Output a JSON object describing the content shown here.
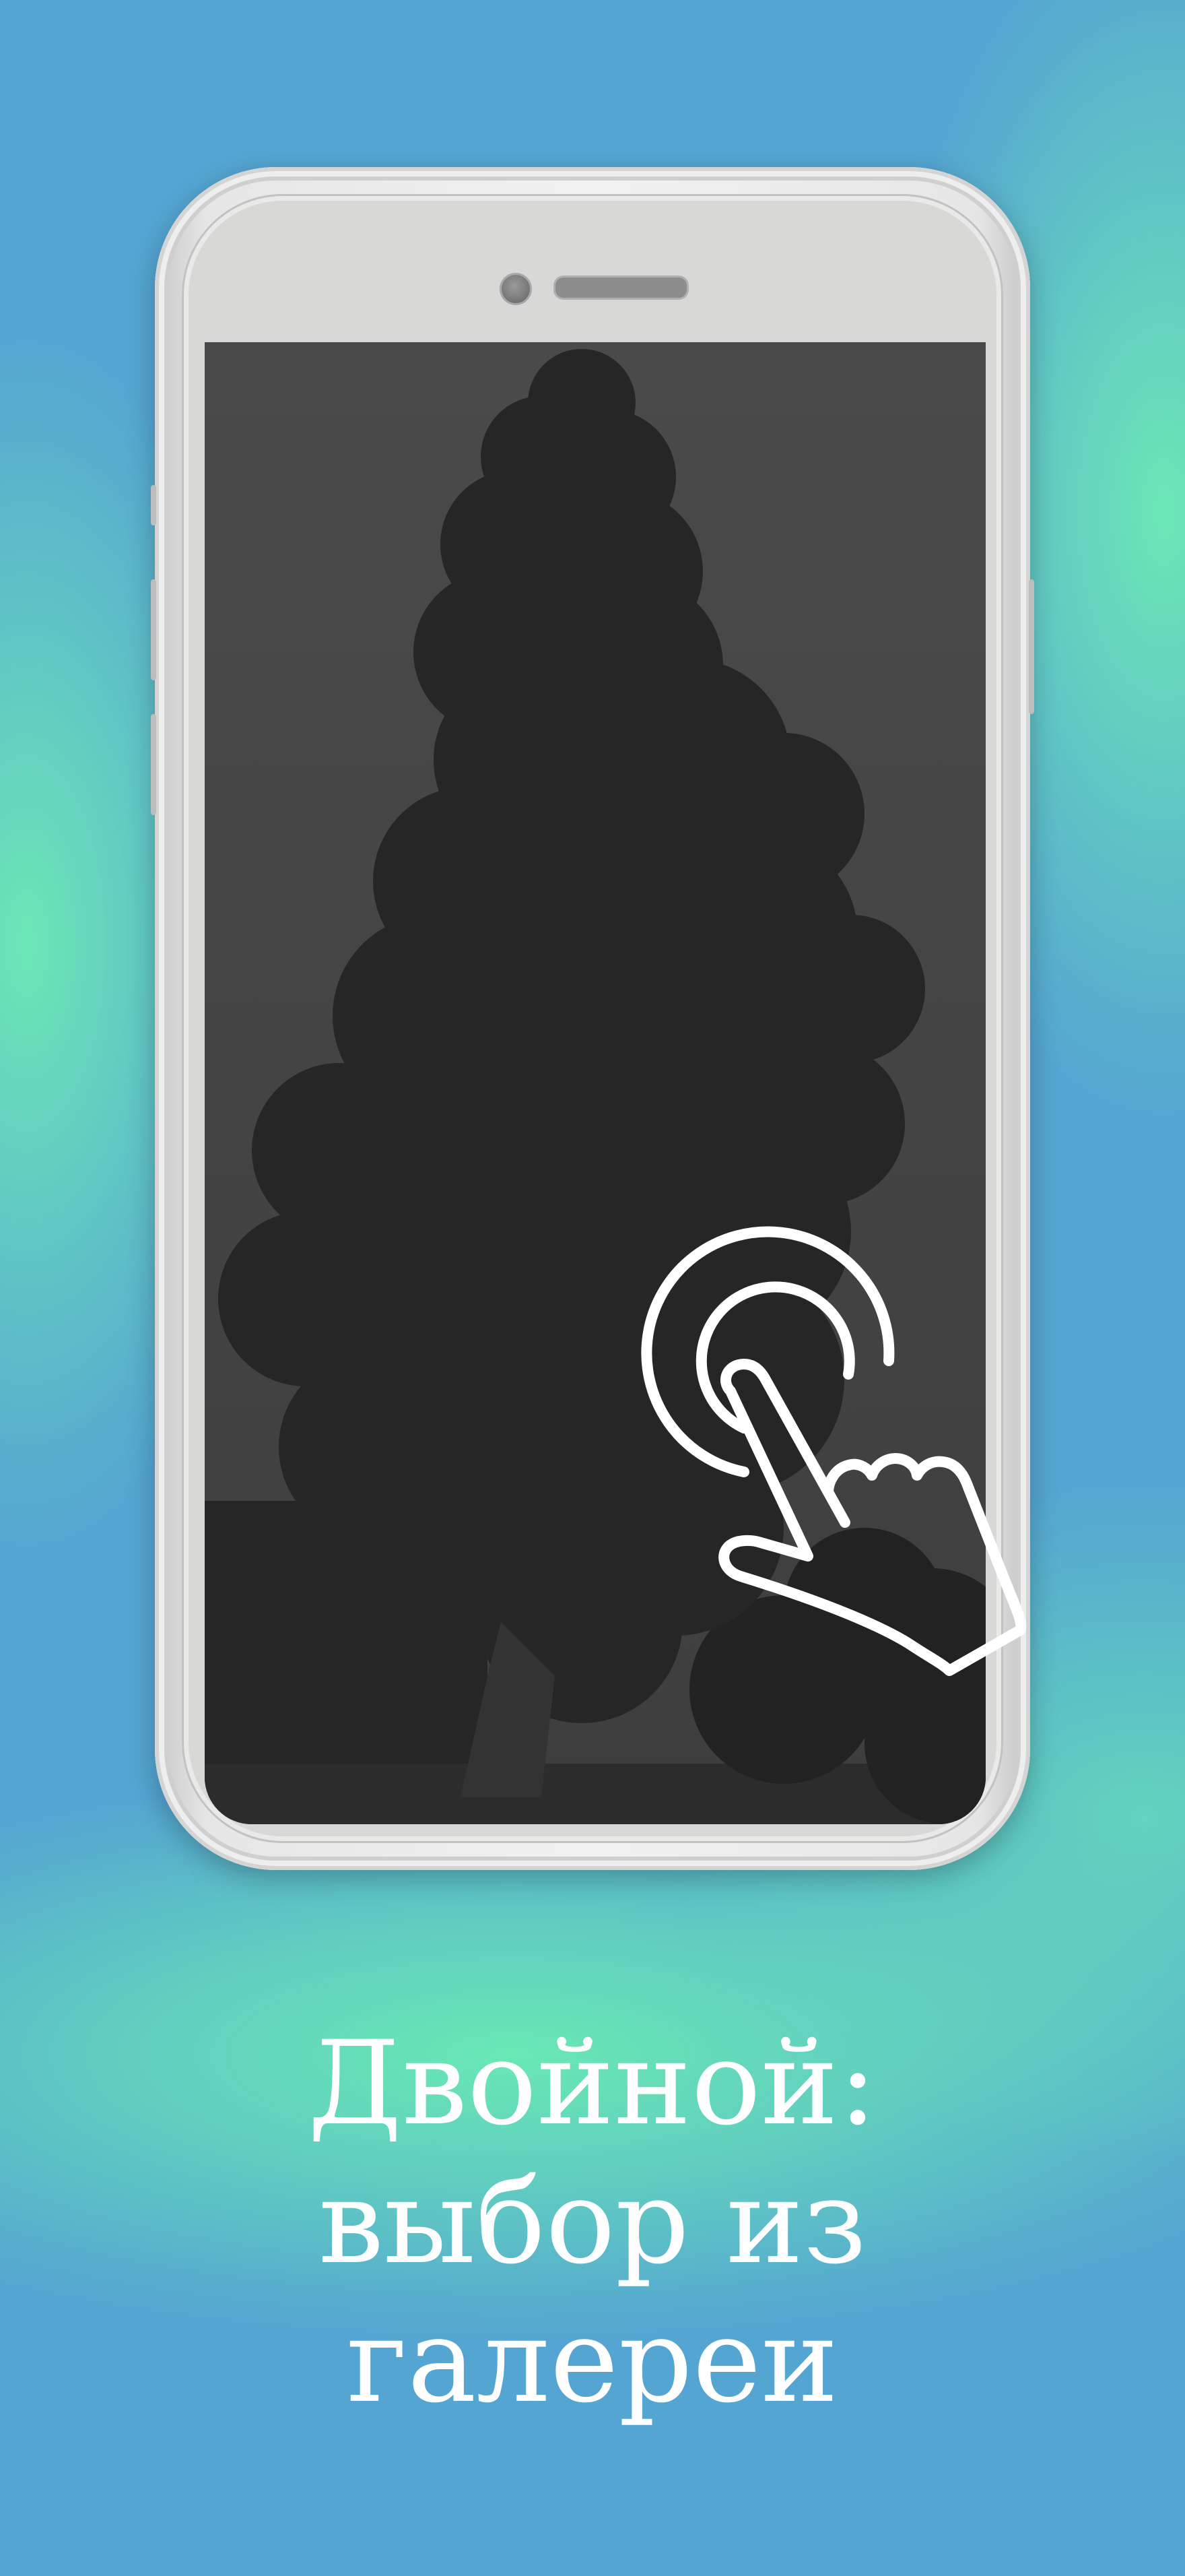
{
  "caption": {
    "line1": "Двойной:",
    "line2": "выбор из",
    "line3": "галереи"
  },
  "colors": {
    "background": "#55a5d2",
    "accent_glow": "#69e8b4",
    "phone_frame": "#e6e6e6",
    "caption_text": "#ffffff"
  },
  "icons": {
    "gesture": "double-tap-hand-icon"
  }
}
